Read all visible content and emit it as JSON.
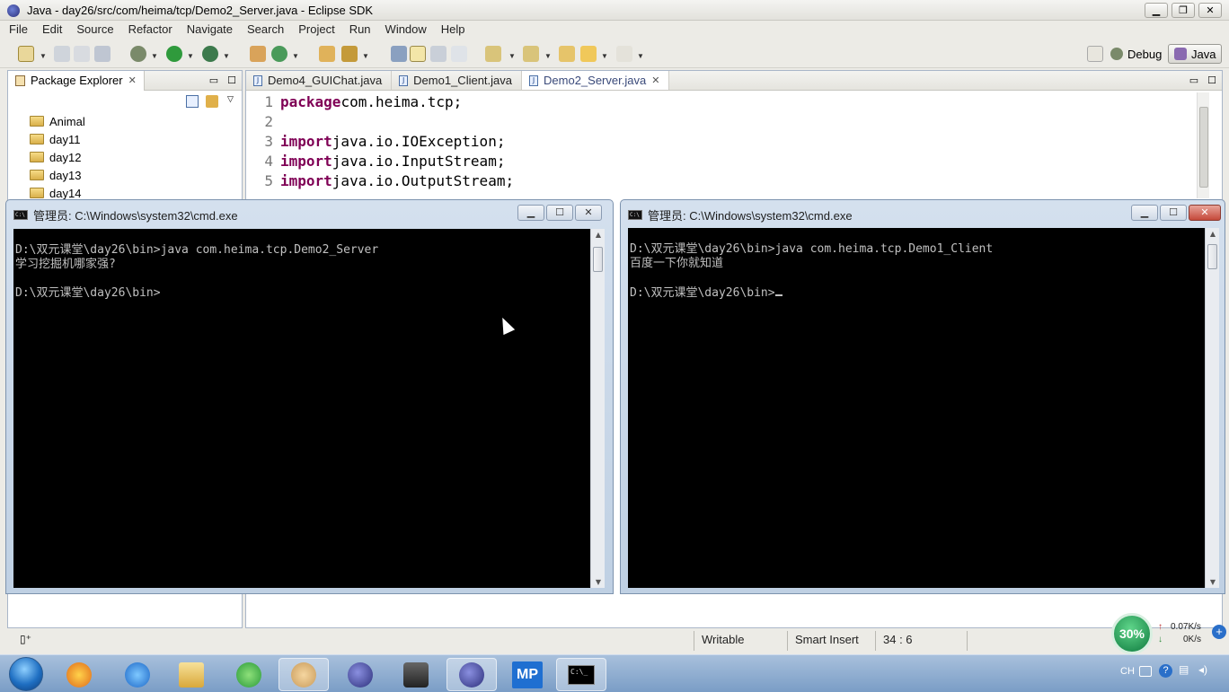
{
  "window": {
    "title": "Java - day26/src/com/heima/tcp/Demo2_Server.java - Eclipse SDK"
  },
  "menu": [
    "File",
    "Edit",
    "Source",
    "Refactor",
    "Navigate",
    "Search",
    "Project",
    "Run",
    "Window",
    "Help"
  ],
  "perspectives": {
    "debug": "Debug",
    "java": "Java"
  },
  "package_explorer": {
    "title": "Package Explorer",
    "items": [
      "Animal",
      "day11",
      "day12",
      "day13",
      "day14"
    ]
  },
  "editor": {
    "tabs": [
      "Demo4_GUIChat.java",
      "Demo1_Client.java",
      "Demo2_Server.java"
    ],
    "active_tab": "Demo2_Server.java",
    "lines": [
      {
        "n": "1",
        "kw": "package",
        "rest": " com.heima.tcp;"
      },
      {
        "n": "2",
        "kw": "",
        "rest": ""
      },
      {
        "n": "3",
        "kw": "import",
        "rest": " java.io.IOException;"
      },
      {
        "n": "4",
        "kw": "import",
        "rest": " java.io.InputStream;"
      },
      {
        "n": "5",
        "kw": "import",
        "rest": " java.io.OutputStream;"
      }
    ]
  },
  "status": {
    "writable": "Writable",
    "insert_mode": "Smart Insert",
    "position": "34 : 6"
  },
  "cmd_left": {
    "title": "管理员: C:\\Windows\\system32\\cmd.exe",
    "lines": [
      "D:\\双元课堂\\day26\\bin>java com.heima.tcp.Demo2_Server",
      "学习挖掘机哪家强?",
      "",
      "D:\\双元课堂\\day26\\bin>"
    ]
  },
  "cmd_right": {
    "title": "管理员: C:\\Windows\\system32\\cmd.exe",
    "lines": [
      "D:\\双元课堂\\day26\\bin>java com.heima.tcp.Demo1_Client",
      "百度一下你就知道",
      "",
      "D:\\双元课堂\\day26\\bin>"
    ]
  },
  "net_widget": {
    "percent": "30%",
    "up": "0.07K/s",
    "down": "0K/s"
  },
  "tray": {
    "lang": "CH"
  },
  "colors": {
    "keyword": "#7f0055",
    "console_bg": "#000000",
    "console_fg": "#c0c0c0"
  }
}
